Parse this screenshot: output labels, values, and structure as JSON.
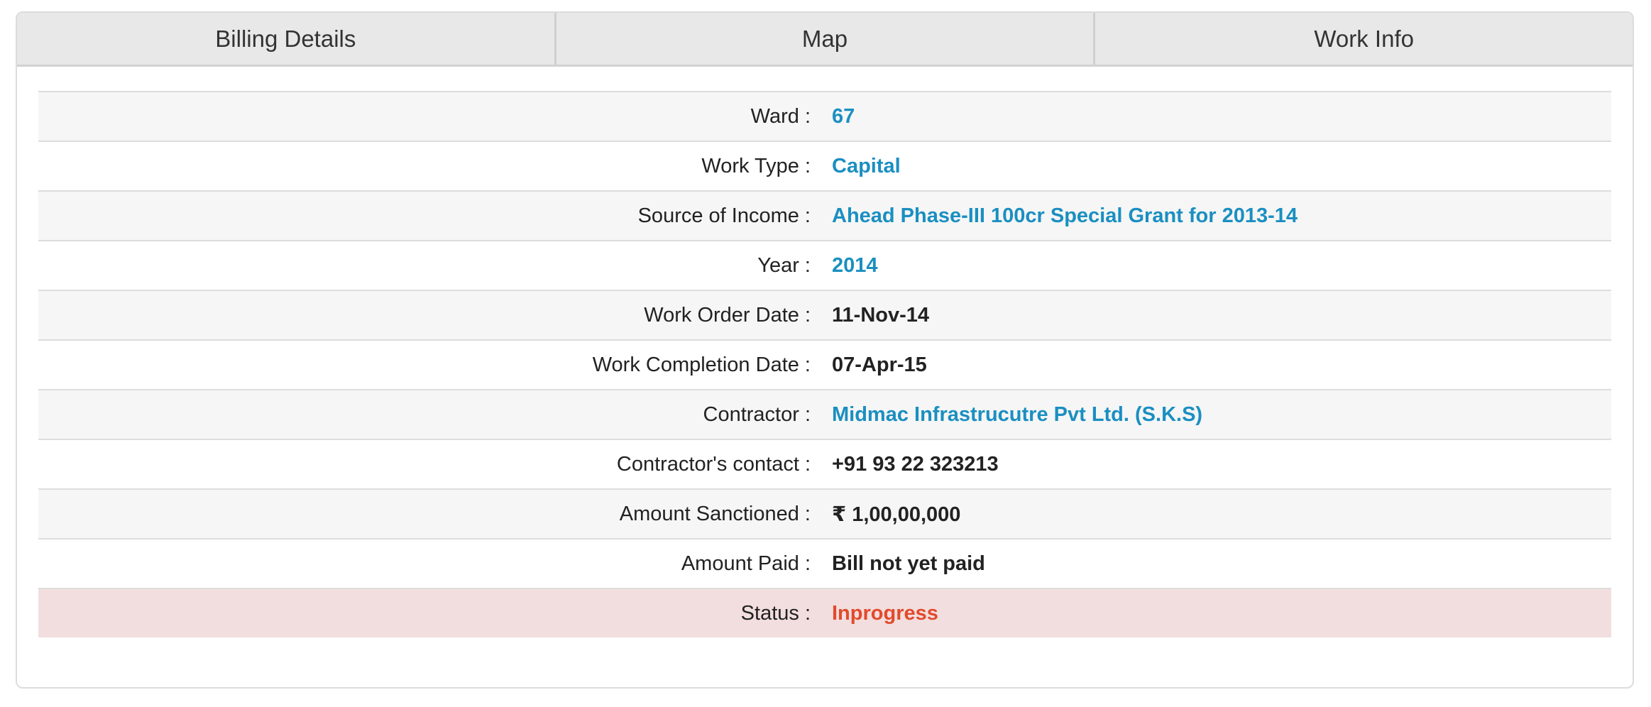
{
  "tabs": [
    {
      "label": "Billing Details"
    },
    {
      "label": "Map"
    },
    {
      "label": "Work Info"
    }
  ],
  "details": {
    "ward": {
      "label": "Ward :",
      "value": "67"
    },
    "work_type": {
      "label": "Work Type :",
      "value": "Capital"
    },
    "source_of_income": {
      "label": "Source of Income :",
      "value": "Ahead Phase-III 100cr Special Grant for 2013-14"
    },
    "year": {
      "label": "Year :",
      "value": "2014"
    },
    "work_order_date": {
      "label": "Work Order Date :",
      "value": "11-Nov-14"
    },
    "work_completion_date": {
      "label": "Work Completion Date :",
      "value": "07-Apr-15"
    },
    "contractor": {
      "label": "Contractor :",
      "value": "Midmac Infrastrucutre Pvt Ltd. (S.K.S)"
    },
    "contractor_contact": {
      "label": "Contractor's contact :",
      "value": "+91 93 22 323213"
    },
    "amount_sanctioned": {
      "label": "Amount Sanctioned :",
      "value": "₹ 1,00,00,000"
    },
    "amount_paid": {
      "label": "Amount Paid :",
      "value": "Bill not yet paid"
    },
    "status": {
      "label": "Status :",
      "value": "Inprogress"
    }
  },
  "colors": {
    "link": "#1a8fc1",
    "status_text": "#e24a2d",
    "status_row_bg": "#f2dede"
  }
}
